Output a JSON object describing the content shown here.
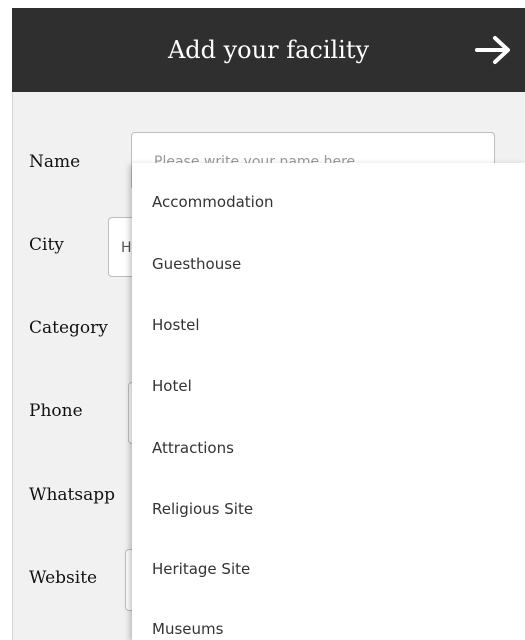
{
  "header": {
    "title": "Add your facility"
  },
  "form": {
    "name_label": "Name",
    "name_placeholder": "Please write your name here",
    "city_label": "City",
    "city_value": "Ht",
    "category_label": "Category",
    "phone_label": "Phone",
    "whatsapp_label": "Whatsapp",
    "website_label": "Website"
  },
  "dropdown": {
    "options": [
      "Accommodation",
      "Guesthouse",
      "Hostel",
      "Hotel",
      "Attractions",
      "Religious Site",
      "Heritage Site",
      "Museums"
    ]
  },
  "icons": {
    "next": "arrow-right-icon"
  },
  "colors": {
    "header_bg": "#2f2f2f",
    "form_bg": "#f1f1f1"
  }
}
